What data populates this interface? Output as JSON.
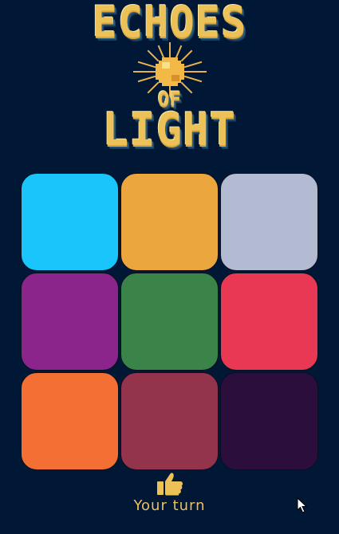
{
  "logo": {
    "line1": "ECHOES",
    "line2": "OF",
    "line3": "LIGHT"
  },
  "colors": {
    "background": "#011736",
    "logo_gold": "#ecc157",
    "status_gold": "#ecc157"
  },
  "tiles": [
    {
      "color": "#19c5fb"
    },
    {
      "color": "#eca63e"
    },
    {
      "color": "#b2bbd2"
    },
    {
      "color": "#8b258c"
    },
    {
      "color": "#3b8449"
    },
    {
      "color": "#e93853"
    },
    {
      "color": "#f36f34"
    },
    {
      "color": "#94334c"
    },
    {
      "color": "#2c0e3c"
    }
  ],
  "status": {
    "icon": "thumbs-up-icon",
    "text": "Your turn"
  }
}
